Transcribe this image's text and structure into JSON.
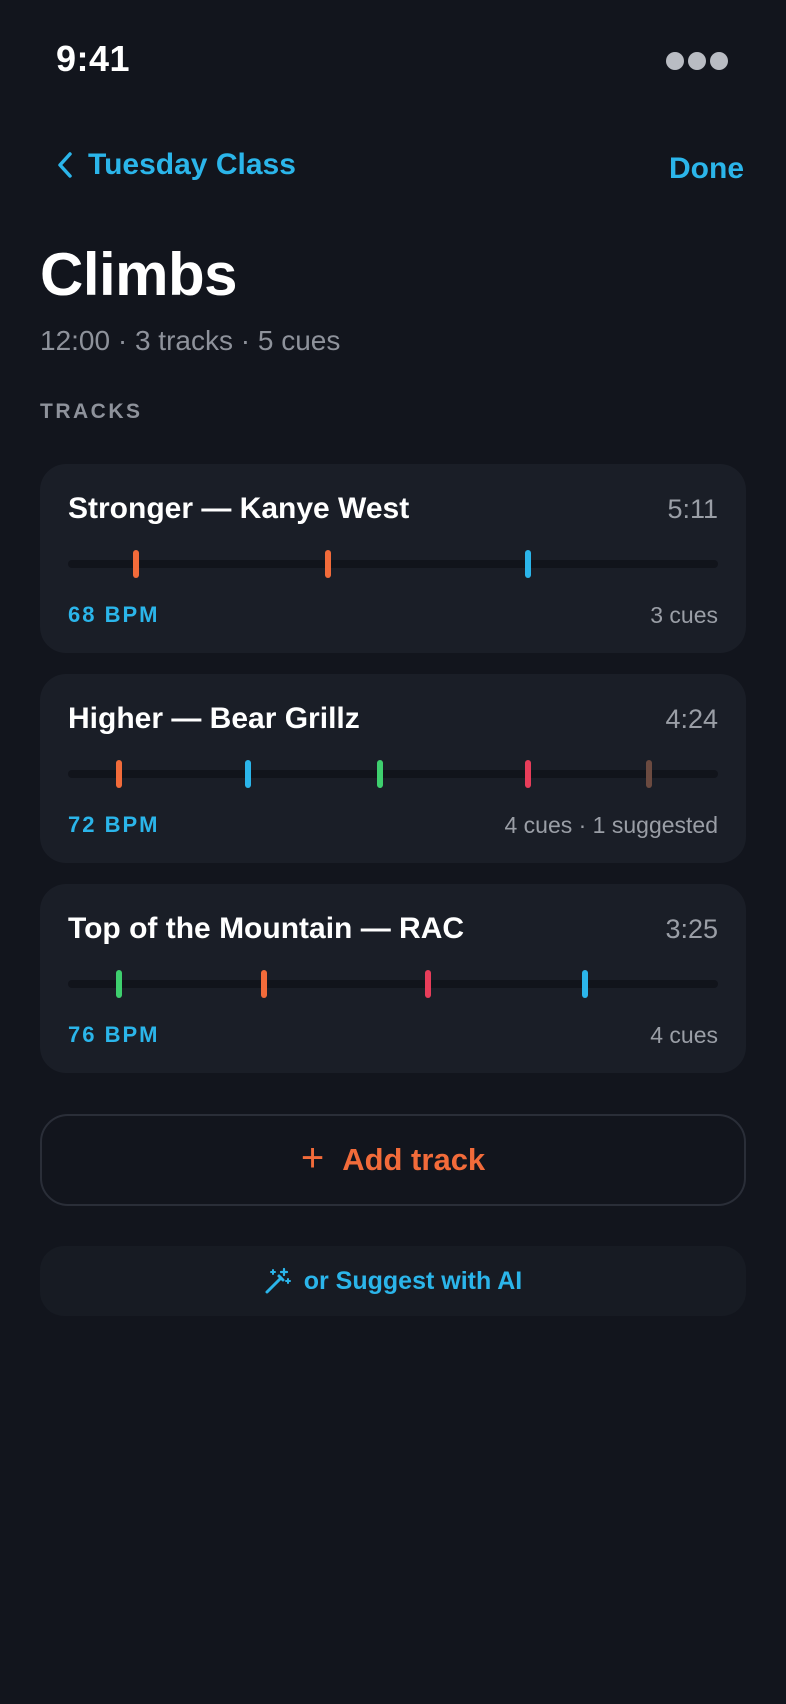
{
  "status_bar": {
    "time": "9:41"
  },
  "nav": {
    "back_label": "Tuesday Class",
    "done_label": "Done"
  },
  "header": {
    "title": "Climbs",
    "subtitle": "12:00 · 3 tracks · 5 cues"
  },
  "section_label": "TRACKS",
  "colors": {
    "accent_blue": "#2bb5ea",
    "accent_orange": "#f26b3a",
    "cue_green": "#3ecf6e",
    "cue_red": "#e83d5a",
    "cue_suggested": "#6b4a40"
  },
  "tracks": [
    {
      "title": "Stronger — Kanye West",
      "duration": "5:11",
      "bpm": "68 BPM",
      "cues_text": "3 cues",
      "cue_marks": [
        {
          "pos": 0.104,
          "color": "#f26b3a"
        },
        {
          "pos": 0.4,
          "color": "#f26b3a"
        },
        {
          "pos": 0.708,
          "color": "#2bb5ea"
        }
      ]
    },
    {
      "title": "Higher — Bear Grillz",
      "duration": "4:24",
      "bpm": "72 BPM",
      "cues_text": "4 cues · 1 suggested",
      "cue_marks": [
        {
          "pos": 0.079,
          "color": "#f26b3a"
        },
        {
          "pos": 0.277,
          "color": "#2bb5ea"
        },
        {
          "pos": 0.48,
          "color": "#3ecf6e"
        },
        {
          "pos": 0.708,
          "color": "#e83d5a"
        },
        {
          "pos": 0.894,
          "color": "#6b4a40"
        }
      ]
    },
    {
      "title": "Top of the Mountain — RAC",
      "duration": "3:25",
      "bpm": "76 BPM",
      "cues_text": "4 cues",
      "cue_marks": [
        {
          "pos": 0.079,
          "color": "#3ecf6e"
        },
        {
          "pos": 0.301,
          "color": "#f26b3a"
        },
        {
          "pos": 0.554,
          "color": "#e83d5a"
        },
        {
          "pos": 0.795,
          "color": "#2bb5ea"
        }
      ]
    }
  ],
  "actions": {
    "add_track_icon": "plus-icon",
    "add_track_label": "Add track",
    "suggest_icon": "magic-wand-icon",
    "suggest_label": "or Suggest with AI"
  }
}
